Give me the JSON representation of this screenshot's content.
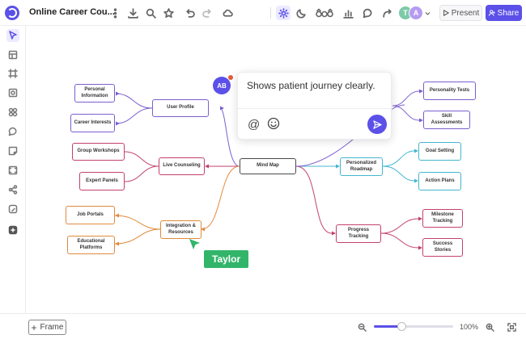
{
  "header": {
    "title": "Online Career Cou...",
    "present_label": "Present",
    "share_label": "Share",
    "avatars": [
      {
        "initial": "T",
        "color": "#7dc9a8"
      },
      {
        "initial": "A",
        "color": "#b59bf0"
      }
    ],
    "icons": [
      "more-vertical-icon",
      "download-icon",
      "search-icon",
      "star-icon",
      "undo-icon",
      "redo-icon",
      "cloud-icon",
      "sun-icon",
      "moon-icon",
      "shapes-icon",
      "chart-icon",
      "comment-icon",
      "connector-icon"
    ]
  },
  "left_toolbar": {
    "icons": [
      "pointer-icon",
      "template-icon",
      "frame-icon",
      "shape-icon",
      "component-icon",
      "comment-icon",
      "sticky-note-icon",
      "image-icon",
      "mindmap-icon",
      "embed-icon",
      "plugin-icon"
    ]
  },
  "bottom_bar": {
    "frame_label": "Frame",
    "zoom_level": "100%",
    "zoom_fraction": 0.35
  },
  "mindmap": {
    "center": "Mind Map",
    "nodes": {
      "user_profile": "User Profile",
      "personal_information": "Personal Information",
      "career_interests": "Career Interests",
      "live_counseling": "Live Counseling",
      "group_workshops": "Group Workshops",
      "expert_panels": "Expert Panels",
      "integration_resources": "Integration & Resources",
      "job_portals": "Job Portals",
      "educational_platforms": "Educational Platforms",
      "personalized_roadmap": "Personalized Roadmap",
      "goal_setting": "Goal Setting",
      "action_plans": "Action Plans",
      "progress_tracking": "Progress Tracking",
      "milestone_tracking": "Milestone Tracking",
      "success_stories": "Success Stories",
      "personality_tests": "Personality Tests",
      "skill_assessments": "Skill Assessments"
    }
  },
  "comment": {
    "avatar_initials": "AB",
    "text": "Shows patient journey clearly.",
    "at_symbol": "@",
    "accent": "#5b50e8"
  },
  "cursor": {
    "name": "Taylor",
    "color": "#32b56a"
  }
}
